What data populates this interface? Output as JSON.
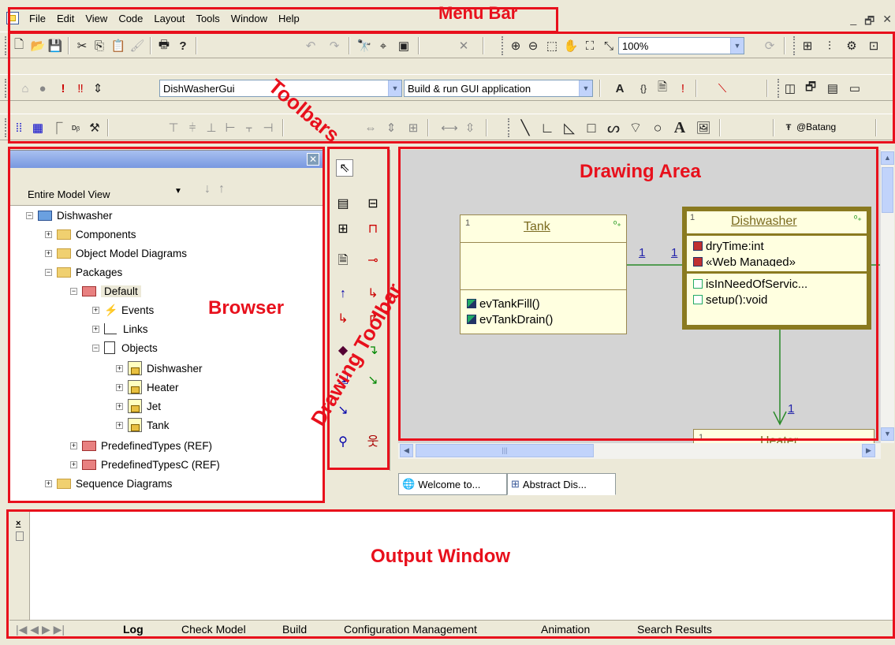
{
  "menu": {
    "items": [
      "File",
      "Edit",
      "View",
      "Code",
      "Layout",
      "Tools",
      "Window",
      "Help"
    ],
    "win_controls": [
      "_",
      "🗗",
      "✕"
    ]
  },
  "toolbars": {
    "zoom_value": "100%",
    "component_combo": "DishWasherGui",
    "config_combo": "Build & run GUI application",
    "font_combo": "@Batang"
  },
  "browser": {
    "view_label": "Entire Model View",
    "tree": [
      {
        "label": "Dishwasher",
        "icon": "project-icon"
      },
      {
        "label": "Components",
        "icon": "folder-icon"
      },
      {
        "label": "Object Model Diagrams",
        "icon": "folder-icon"
      },
      {
        "label": "Packages",
        "icon": "folder-icon"
      },
      {
        "label": "Default",
        "icon": "package-icon"
      },
      {
        "label": "Events",
        "icon": "event-icon"
      },
      {
        "label": "Links",
        "icon": "link-icon"
      },
      {
        "label": "Objects",
        "icon": "objects-icon"
      },
      {
        "label": "Dishwasher",
        "icon": "object-icon"
      },
      {
        "label": "Heater",
        "icon": "object-icon"
      },
      {
        "label": "Jet",
        "icon": "object-icon"
      },
      {
        "label": "Tank",
        "icon": "object-icon"
      },
      {
        "label": "PredefinedTypes (REF)",
        "icon": "package-icon"
      },
      {
        "label": "PredefinedTypesC (REF)",
        "icon": "package-icon"
      },
      {
        "label": "Sequence Diagrams",
        "icon": "folder-icon"
      }
    ]
  },
  "diagram": {
    "tank": {
      "num": "1",
      "name": "Tank",
      "ops": [
        "evTankFill()",
        "evTankDrain()"
      ]
    },
    "dishwasher": {
      "num": "1",
      "name": "Dishwasher",
      "attrs": [
        "dryTime:int",
        "«Web Managed»"
      ],
      "ops": [
        "isInNeedOfServic...",
        "setup():void"
      ]
    },
    "heater": {
      "num": "1",
      "name": "Heater"
    },
    "mult_left": "1",
    "mult_right": "1",
    "mult_down": "1"
  },
  "doc_tabs": [
    "Welcome to...",
    "Abstract Dis..."
  ],
  "output_tabs": [
    "Log",
    "Check Model",
    "Build",
    "Configuration Management",
    "Animation",
    "Search Results"
  ],
  "annotations": {
    "menu_bar": "Menu Bar",
    "toolbars": "Toolbars",
    "browser": "Browser",
    "drawing_toolbar": "Drawing Toolbar",
    "drawing_area": "Drawing Area",
    "output_window": "Output Window"
  },
  "colors": {
    "annotation": "#e8101c",
    "selected_border": "#8a7a20"
  }
}
